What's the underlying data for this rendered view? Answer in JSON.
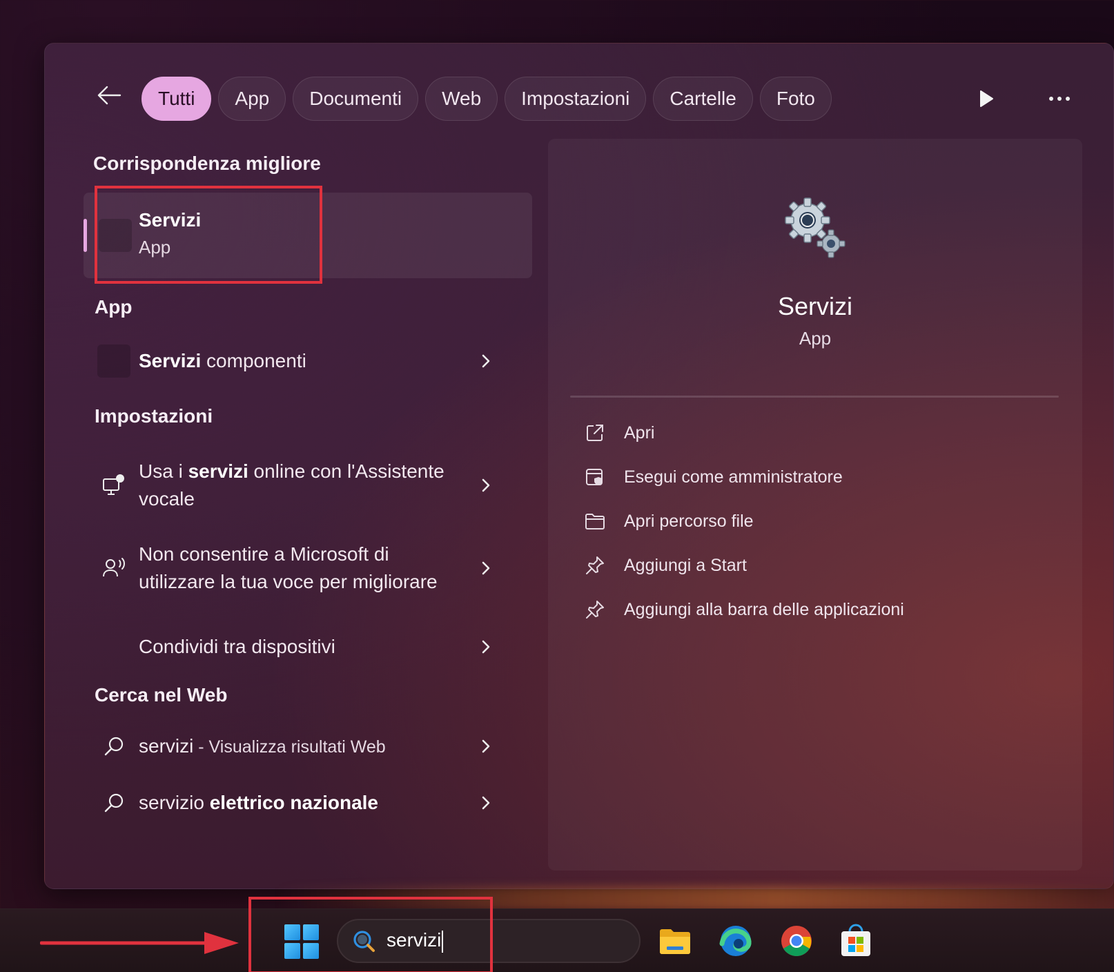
{
  "filters": {
    "tabs": [
      {
        "label": "Tutti",
        "active": true
      },
      {
        "label": "App",
        "active": false
      },
      {
        "label": "Documenti",
        "active": false
      },
      {
        "label": "Web",
        "active": false
      },
      {
        "label": "Impostazioni",
        "active": false
      },
      {
        "label": "Cartelle",
        "active": false
      },
      {
        "label": "Foto",
        "active": false
      }
    ]
  },
  "best_match": {
    "title": "Corrispondenza migliore",
    "name": "Servizi",
    "type": "App"
  },
  "apps": {
    "title": "App",
    "item_bold": "Servizi",
    "item_rest": " componenti"
  },
  "settings": {
    "title": "Impostazioni",
    "items": [
      {
        "pre": "Usa i ",
        "bold": "servizi",
        "post": " online con l'Assistente vocale",
        "icon": "monitor-voice-icon"
      },
      {
        "pre": "Non consentire a Microsoft di utilizzare la tua voce per migliorare",
        "bold": "",
        "post": "",
        "icon": "person-voice-icon"
      },
      {
        "pre": "Condividi tra dispositivi",
        "bold": "",
        "post": "",
        "icon": ""
      }
    ]
  },
  "web": {
    "title": "Cerca nel Web",
    "items": [
      {
        "main": "servizi",
        "suffix": " - Visualizza risultati Web"
      },
      {
        "main": "servizio ",
        "bold": "elettrico nazionale"
      }
    ]
  },
  "preview": {
    "name": "Servizi",
    "type": "App",
    "actions": [
      {
        "label": "Apri",
        "icon": "open-external-icon"
      },
      {
        "label": "Esegui come amministratore",
        "icon": "shield-admin-icon"
      },
      {
        "label": "Apri percorso file",
        "icon": "folder-icon"
      },
      {
        "label": "Aggiungi a Start",
        "icon": "pin-icon"
      },
      {
        "label": "Aggiungi alla barra delle applicazioni",
        "icon": "pin-icon"
      }
    ]
  },
  "taskbar": {
    "search_value": "servizi",
    "apps": [
      "file-explorer-icon",
      "edge-icon",
      "chrome-icon",
      "store-icon"
    ]
  },
  "colors": {
    "accent": "#e6a7e1",
    "highlight": "#e0323e"
  }
}
